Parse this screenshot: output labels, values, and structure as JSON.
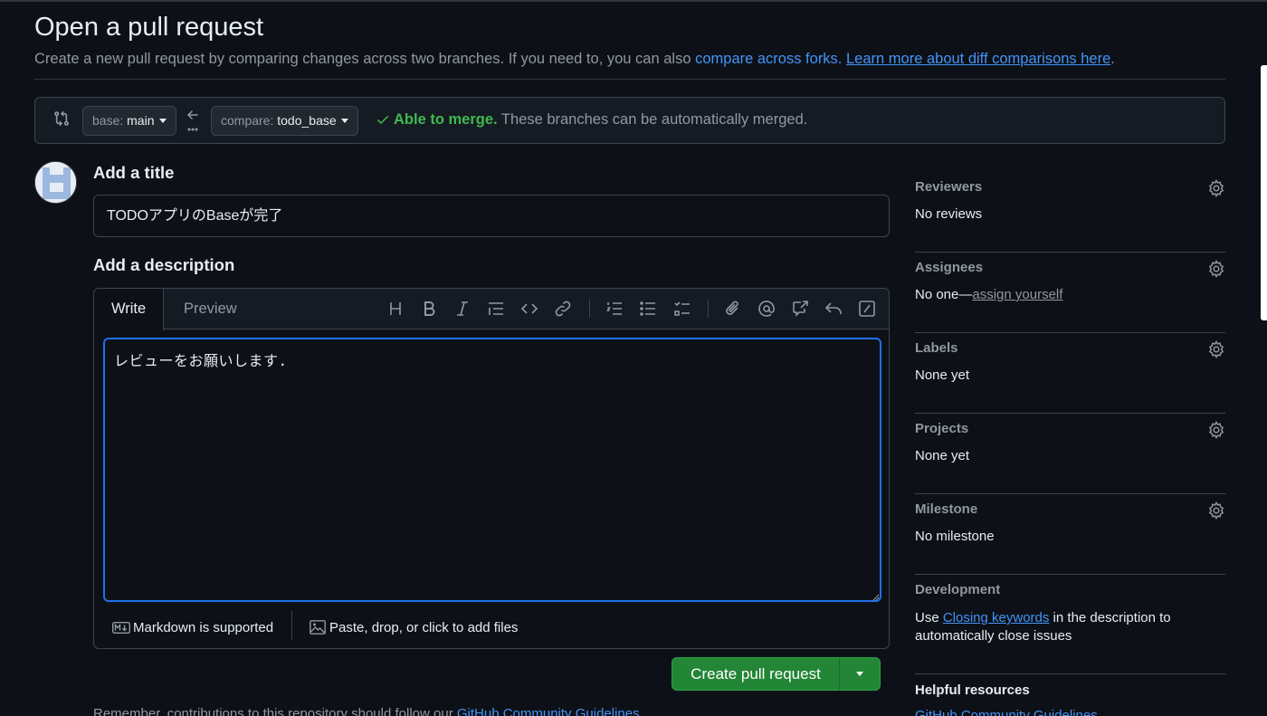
{
  "header": {
    "title": "Open a pull request",
    "subtitle_text": "Create a new pull request by comparing changes across two branches. If you need to, you can also ",
    "compare_forks_link": "compare across forks.",
    "learn_more_link": "Learn more about diff comparisons here",
    "trailing_period": "."
  },
  "range": {
    "base_prefix": "base: ",
    "base_branch": "main",
    "compare_prefix": "compare: ",
    "compare_branch": "todo_base",
    "merge_ok": "Able to merge.",
    "merge_text": " These branches can be automatically merged."
  },
  "form": {
    "title_label": "Add a title",
    "title_value": "TODOアプリのBaseが完了",
    "description_label": "Add a description",
    "tabs": [
      "Write",
      "Preview"
    ],
    "body_value": "レビューをお願いします.",
    "markdown_note": "Markdown is supported",
    "attach_note": "Paste, drop, or click to add files",
    "submit_label": "Create pull request"
  },
  "footnote": {
    "text": "Remember, contributions to this repository should follow our ",
    "link": "GitHub Community Guidelines"
  },
  "sidebar": {
    "reviewers": {
      "title": "Reviewers",
      "value": "No reviews"
    },
    "assignees": {
      "title": "Assignees",
      "value": "No one—",
      "link": "assign yourself"
    },
    "labels": {
      "title": "Labels",
      "value": "None yet"
    },
    "projects": {
      "title": "Projects",
      "value": "None yet"
    },
    "milestone": {
      "title": "Milestone",
      "value": "No milestone"
    },
    "development": {
      "title": "Development",
      "prefix": "Use ",
      "link": "Closing keywords",
      "suffix": " in the description to automatically close issues"
    },
    "helpful_title": "Helpful resources",
    "helpful_link": "GitHub Community Guidelines"
  },
  "colors": {
    "background": "#0d1117",
    "accent_blue": "#4493f8",
    "success_green": "#3fb950",
    "button_green": "#238636"
  }
}
